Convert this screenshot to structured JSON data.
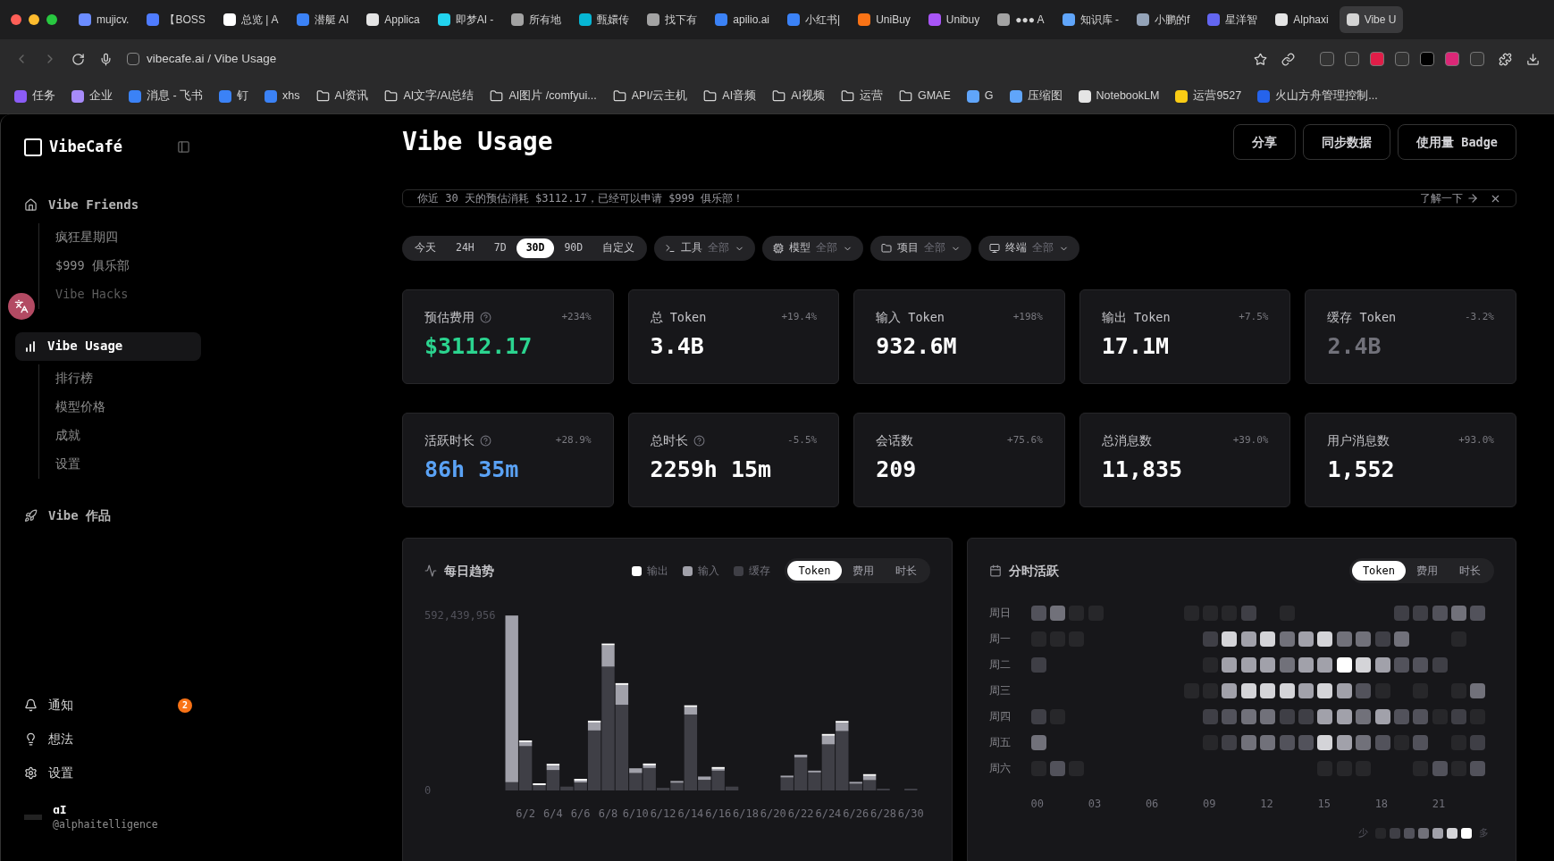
{
  "browser": {
    "tabs": [
      {
        "title": "mujicv.",
        "color": "#6b8cff",
        "selected": false
      },
      {
        "title": "【BOSS",
        "color": "#4f7cff",
        "selected": false
      },
      {
        "title": "总览 | A",
        "color": "#ffffff",
        "selected": false
      },
      {
        "title": "潜艇 AI",
        "color": "#3b82f6",
        "selected": false
      },
      {
        "title": "Applica",
        "color": "#e5e5e5",
        "selected": false
      },
      {
        "title": "即梦AI -",
        "color": "#22d3ee",
        "selected": false
      },
      {
        "title": "所有地",
        "color": "#a3a3a3",
        "selected": false
      },
      {
        "title": "甄嬛传",
        "color": "#06b6d4",
        "selected": false
      },
      {
        "title": "找下有",
        "color": "#a3a3a3",
        "selected": false
      },
      {
        "title": "apilio.ai",
        "color": "#3b82f6",
        "selected": false
      },
      {
        "title": "小红书|",
        "color": "#3b82f6",
        "selected": false
      },
      {
        "title": "UniBuy",
        "color": "#f97316",
        "selected": false
      },
      {
        "title": "Unibuy",
        "color": "#a855f7",
        "selected": false
      },
      {
        "title": "●●● A",
        "color": "#a3a3a3",
        "selected": false
      },
      {
        "title": "知识库 -",
        "color": "#60a5fa",
        "selected": false
      },
      {
        "title": "小鹏的f",
        "color": "#94a3b8",
        "selected": false
      },
      {
        "title": "星洋智",
        "color": "#6366f1",
        "selected": false
      },
      {
        "title": "Alphaxi",
        "color": "#e5e5e5",
        "selected": false
      },
      {
        "title": "Vibe U",
        "color": "#d4d4d4",
        "selected": true
      }
    ],
    "url": "vibecafe.ai / Vibe Usage",
    "bookmarks": [
      {
        "label": "任务",
        "kind": "site",
        "color": "#8b5cf6"
      },
      {
        "label": "企业",
        "kind": "site",
        "color": "#a78bfa"
      },
      {
        "label": "消息 - 飞书",
        "kind": "site",
        "color": "#3b82f6"
      },
      {
        "label": "钉",
        "kind": "site",
        "color": "#3b82f6"
      },
      {
        "label": "xhs",
        "kind": "site",
        "color": "#3b82f6"
      },
      {
        "label": "AI资讯",
        "kind": "folder"
      },
      {
        "label": "AI文字/AI总结",
        "kind": "folder"
      },
      {
        "label": "AI图片 /comfyui...",
        "kind": "folder"
      },
      {
        "label": "API/云主机",
        "kind": "folder"
      },
      {
        "label": "AI音频",
        "kind": "folder"
      },
      {
        "label": "AI视频",
        "kind": "folder"
      },
      {
        "label": "运营",
        "kind": "folder"
      },
      {
        "label": "GMAE",
        "kind": "folder"
      },
      {
        "label": "G",
        "kind": "site",
        "color": "#60a5fa"
      },
      {
        "label": "压缩图",
        "kind": "site",
        "color": "#60a5fa"
      },
      {
        "label": "NotebookLM",
        "kind": "site",
        "color": "#e5e5e5"
      },
      {
        "label": "运营9527",
        "kind": "site",
        "color": "#facc15"
      },
      {
        "label": "火山方舟管理控制...",
        "kind": "site",
        "color": "#2563eb"
      }
    ]
  },
  "sidebar": {
    "brand": "VibeCafé",
    "sections": [
      {
        "label": "Vibe Friends",
        "selected": false,
        "children": [
          {
            "label": "疯狂星期四",
            "disabled": false
          },
          {
            "label": "$999 俱乐部",
            "disabled": false
          },
          {
            "label": "Vibe Hacks",
            "disabled": true
          }
        ]
      },
      {
        "label": "Vibe Usage",
        "selected": true,
        "children": [
          {
            "label": "排行榜",
            "disabled": false
          },
          {
            "label": "模型价格",
            "disabled": false
          },
          {
            "label": "成就",
            "disabled": false
          },
          {
            "label": "设置",
            "disabled": false
          }
        ]
      },
      {
        "label": "Vibe 作品",
        "selected": false
      }
    ],
    "bottom": [
      {
        "label": "通知",
        "badge": "2"
      },
      {
        "label": "想法"
      },
      {
        "label": "设置"
      }
    ],
    "user": {
      "name": "ɑI",
      "handle": "@alphaitelligence"
    }
  },
  "header": {
    "title": "Vibe Usage",
    "buttons": [
      "分享",
      "同步数据",
      "使用量 Badge"
    ]
  },
  "banner": {
    "text": "你近 30 天的预估消耗 $3112.17，已经可以申请 $999 俱乐部！",
    "link": "了解一下"
  },
  "filters": {
    "ranges": [
      {
        "label": "今天",
        "selected": false
      },
      {
        "label": "24H",
        "selected": false
      },
      {
        "label": "7D",
        "selected": false
      },
      {
        "label": "30D",
        "selected": true
      },
      {
        "label": "90D",
        "selected": false
      },
      {
        "label": "自定义",
        "selected": false
      }
    ],
    "dropdowns": [
      {
        "label": "工具",
        "value": "全部"
      },
      {
        "label": "模型",
        "value": "全部"
      },
      {
        "label": "项目",
        "value": "全部"
      },
      {
        "label": "终端",
        "value": "全部"
      }
    ]
  },
  "stats": [
    {
      "label": "预估费用",
      "help": true,
      "change": "+234%",
      "value": "$3112.17",
      "color": "#2bd48f"
    },
    {
      "label": "总 Token",
      "help": false,
      "change": "+19.4%",
      "value": "3.4B",
      "color": "#ffffff"
    },
    {
      "label": "输入 Token",
      "help": false,
      "change": "+198%",
      "value": "932.6M",
      "color": "#ffffff"
    },
    {
      "label": "输出 Token",
      "help": false,
      "change": "+7.5%",
      "value": "17.1M",
      "color": "#ffffff"
    },
    {
      "label": "缓存 Token",
      "help": false,
      "change": "-3.2%",
      "value": "2.4B",
      "color": "#71717a"
    },
    {
      "label": "活跃时长",
      "help": true,
      "change": "+28.9%",
      "value": "86h 35m",
      "color": "#5aa2f5"
    },
    {
      "label": "总时长",
      "help": true,
      "change": "-5.5%",
      "value": "2259h 15m",
      "color": "#ffffff"
    },
    {
      "label": "会话数",
      "help": false,
      "change": "+75.6%",
      "value": "209",
      "color": "#ffffff"
    },
    {
      "label": "总消息数",
      "help": false,
      "change": "+39.0%",
      "value": "11,835",
      "color": "#ffffff"
    },
    {
      "label": "用户消息数",
      "help": false,
      "change": "+93.0%",
      "value": "1,552",
      "color": "#ffffff"
    }
  ],
  "daily": {
    "title": "每日趋势",
    "modes": [
      {
        "label": "Token",
        "selected": true
      },
      {
        "label": "费用",
        "selected": false
      },
      {
        "label": "时长",
        "selected": false
      }
    ],
    "chart_data": {
      "type": "bar",
      "stacked": true,
      "categories": [
        null,
        "6/2",
        null,
        "6/4",
        null,
        "6/6",
        null,
        "6/8",
        null,
        "6/10",
        null,
        "6/12",
        null,
        "6/14",
        null,
        "6/16",
        null,
        "6/18",
        null,
        "6/20",
        null,
        "6/22",
        null,
        "6/24",
        null,
        "6/26",
        null,
        "6/28",
        null,
        "6/30"
      ],
      "ylim": [
        0,
        592439956
      ],
      "yticks": [
        0,
        {
          "value": 592439956,
          "label": "592,439,956"
        }
      ],
      "series": [
        {
          "name": "缓存",
          "color": "#3f3f46",
          "values": [
            28000000,
            150000000,
            18000000,
            69000000,
            13000000,
            27000000,
            203000000,
            419000000,
            290000000,
            59000000,
            76000000,
            9000000,
            26000000,
            257000000,
            36000000,
            67000000,
            13000000,
            0,
            0,
            0,
            44000000,
            112000000,
            61000000,
            156000000,
            201000000,
            23000000,
            35000000,
            5000000,
            0,
            1000000
          ]
        },
        {
          "name": "输入",
          "color": "#a1a1aa",
          "values": [
            564000000,
            13000000,
            0,
            15000000,
            0,
            2000000,
            27000000,
            72000000,
            67000000,
            16000000,
            9000000,
            0,
            3000000,
            25000000,
            11000000,
            5000000,
            0,
            0,
            0,
            0,
            2000000,
            9000000,
            4000000,
            29000000,
            28000000,
            4000000,
            14000000,
            0,
            0,
            0
          ]
        },
        {
          "name": "输出",
          "color": "#ffffff",
          "values": [
            0,
            3000000,
            1000000,
            2000000,
            0,
            1000000,
            1000000,
            3000000,
            4000000,
            0,
            2000000,
            0,
            0,
            3000000,
            0,
            3000000,
            0,
            0,
            0,
            0,
            0,
            0,
            0,
            3000000,
            2000000,
            0,
            3000000,
            0,
            0,
            0
          ]
        }
      ]
    }
  },
  "hourly": {
    "title": "分时活跃",
    "modes": [
      {
        "label": "Token",
        "selected": true
      },
      {
        "label": "费用",
        "selected": false
      },
      {
        "label": "时长",
        "selected": false
      }
    ],
    "hour_labels": [
      "00",
      "03",
      "06",
      "09",
      "12",
      "15",
      "18",
      "21"
    ],
    "rows": [
      {
        "label": "周日",
        "cells": [
          {
            "color": "#52525b"
          },
          {
            "color": "#71717a"
          },
          {
            "color": "#27272a"
          },
          {
            "color": "#27272a"
          },
          null,
          null,
          null,
          null,
          {
            "color": "#27272a"
          },
          {
            "color": "#27272a"
          },
          {
            "color": "#27272a"
          },
          {
            "color": "#3f3f46"
          },
          null,
          {
            "color": "#27272a"
          },
          null,
          null,
          null,
          null,
          null,
          {
            "color": "#3f3f46"
          },
          {
            "color": "#3f3f46"
          },
          {
            "color": "#52525b"
          },
          {
            "color": "#71717a"
          },
          {
            "color": "#52525b"
          }
        ]
      },
      {
        "label": "周一",
        "cells": [
          {
            "color": "#27272a"
          },
          {
            "color": "#27272a"
          },
          {
            "color": "#27272a"
          },
          null,
          null,
          null,
          null,
          null,
          null,
          {
            "color": "#3f3f46"
          },
          {
            "color": "#d4d4d8"
          },
          {
            "color": "#a1a1aa"
          },
          {
            "color": "#d4d4d8"
          },
          {
            "color": "#71717a"
          },
          {
            "color": "#a1a1aa"
          },
          {
            "color": "#d4d4d8"
          },
          {
            "color": "#71717a"
          },
          {
            "color": "#71717a"
          },
          {
            "color": "#3f3f46"
          },
          {
            "color": "#71717a"
          },
          null,
          null,
          {
            "color": "#27272a"
          },
          null
        ]
      },
      {
        "label": "周二",
        "cells": [
          {
            "color": "#3f3f46"
          },
          null,
          null,
          null,
          null,
          null,
          null,
          null,
          null,
          {
            "color": "#27272a"
          },
          {
            "color": "#a1a1aa"
          },
          {
            "color": "#a1a1aa"
          },
          {
            "color": "#a1a1aa"
          },
          {
            "color": "#71717a"
          },
          {
            "color": "#a1a1aa"
          },
          {
            "color": "#a1a1aa"
          },
          {
            "color": "#ffffff"
          },
          {
            "color": "#d4d4d8"
          },
          {
            "color": "#a1a1aa"
          },
          {
            "color": "#52525b"
          },
          {
            "color": "#52525b"
          },
          {
            "color": "#3f3f46"
          },
          null,
          null
        ]
      },
      {
        "label": "周三",
        "cells": [
          null,
          null,
          null,
          null,
          null,
          null,
          null,
          null,
          {
            "color": "#27272a"
          },
          {
            "color": "#27272a"
          },
          {
            "color": "#a1a1aa"
          },
          {
            "color": "#d4d4d8"
          },
          {
            "color": "#d4d4d8"
          },
          {
            "color": "#d4d4d8"
          },
          {
            "color": "#a1a1aa"
          },
          {
            "color": "#d4d4d8"
          },
          {
            "color": "#a1a1aa"
          },
          {
            "color": "#52525b"
          },
          {
            "color": "#27272a"
          },
          null,
          {
            "color": "#27272a"
          },
          null,
          {
            "color": "#27272a"
          },
          {
            "color": "#71717a"
          }
        ]
      },
      {
        "label": "周四",
        "cells": [
          {
            "color": "#3f3f46"
          },
          {
            "color": "#27272a"
          },
          null,
          null,
          null,
          null,
          null,
          null,
          null,
          {
            "color": "#3f3f46"
          },
          {
            "color": "#52525b"
          },
          {
            "color": "#71717a"
          },
          {
            "color": "#71717a"
          },
          {
            "color": "#3f3f46"
          },
          {
            "color": "#3f3f46"
          },
          {
            "color": "#a1a1aa"
          },
          {
            "color": "#a1a1aa"
          },
          {
            "color": "#71717a"
          },
          {
            "color": "#a1a1aa"
          },
          {
            "color": "#52525b"
          },
          {
            "color": "#52525b"
          },
          {
            "color": "#27272a"
          },
          {
            "color": "#3f3f46"
          },
          {
            "color": "#27272a"
          }
        ]
      },
      {
        "label": "周五",
        "cells": [
          {
            "color": "#71717a"
          },
          null,
          null,
          null,
          null,
          null,
          null,
          null,
          null,
          {
            "color": "#27272a"
          },
          {
            "color": "#3f3f46"
          },
          {
            "color": "#71717a"
          },
          {
            "color": "#71717a"
          },
          {
            "color": "#52525b"
          },
          {
            "color": "#52525b"
          },
          {
            "color": "#d4d4d8"
          },
          {
            "color": "#a1a1aa"
          },
          {
            "color": "#71717a"
          },
          {
            "color": "#52525b"
          },
          {
            "color": "#27272a"
          },
          {
            "color": "#52525b"
          },
          null,
          {
            "color": "#27272a"
          },
          {
            "color": "#3f3f46"
          }
        ]
      },
      {
        "label": "周六",
        "cells": [
          {
            "color": "#27272a"
          },
          {
            "color": "#52525b"
          },
          {
            "color": "#27272a"
          },
          null,
          null,
          null,
          null,
          null,
          null,
          null,
          null,
          null,
          null,
          null,
          null,
          {
            "color": "#27272a"
          },
          {
            "color": "#27272a"
          },
          {
            "color": "#27272a"
          },
          null,
          null,
          {
            "color": "#27272a"
          },
          {
            "color": "#52525b"
          },
          {
            "color": "#27272a"
          },
          {
            "color": "#52525b"
          }
        ]
      }
    ],
    "legend_low": "少",
    "legend_high": "多"
  }
}
